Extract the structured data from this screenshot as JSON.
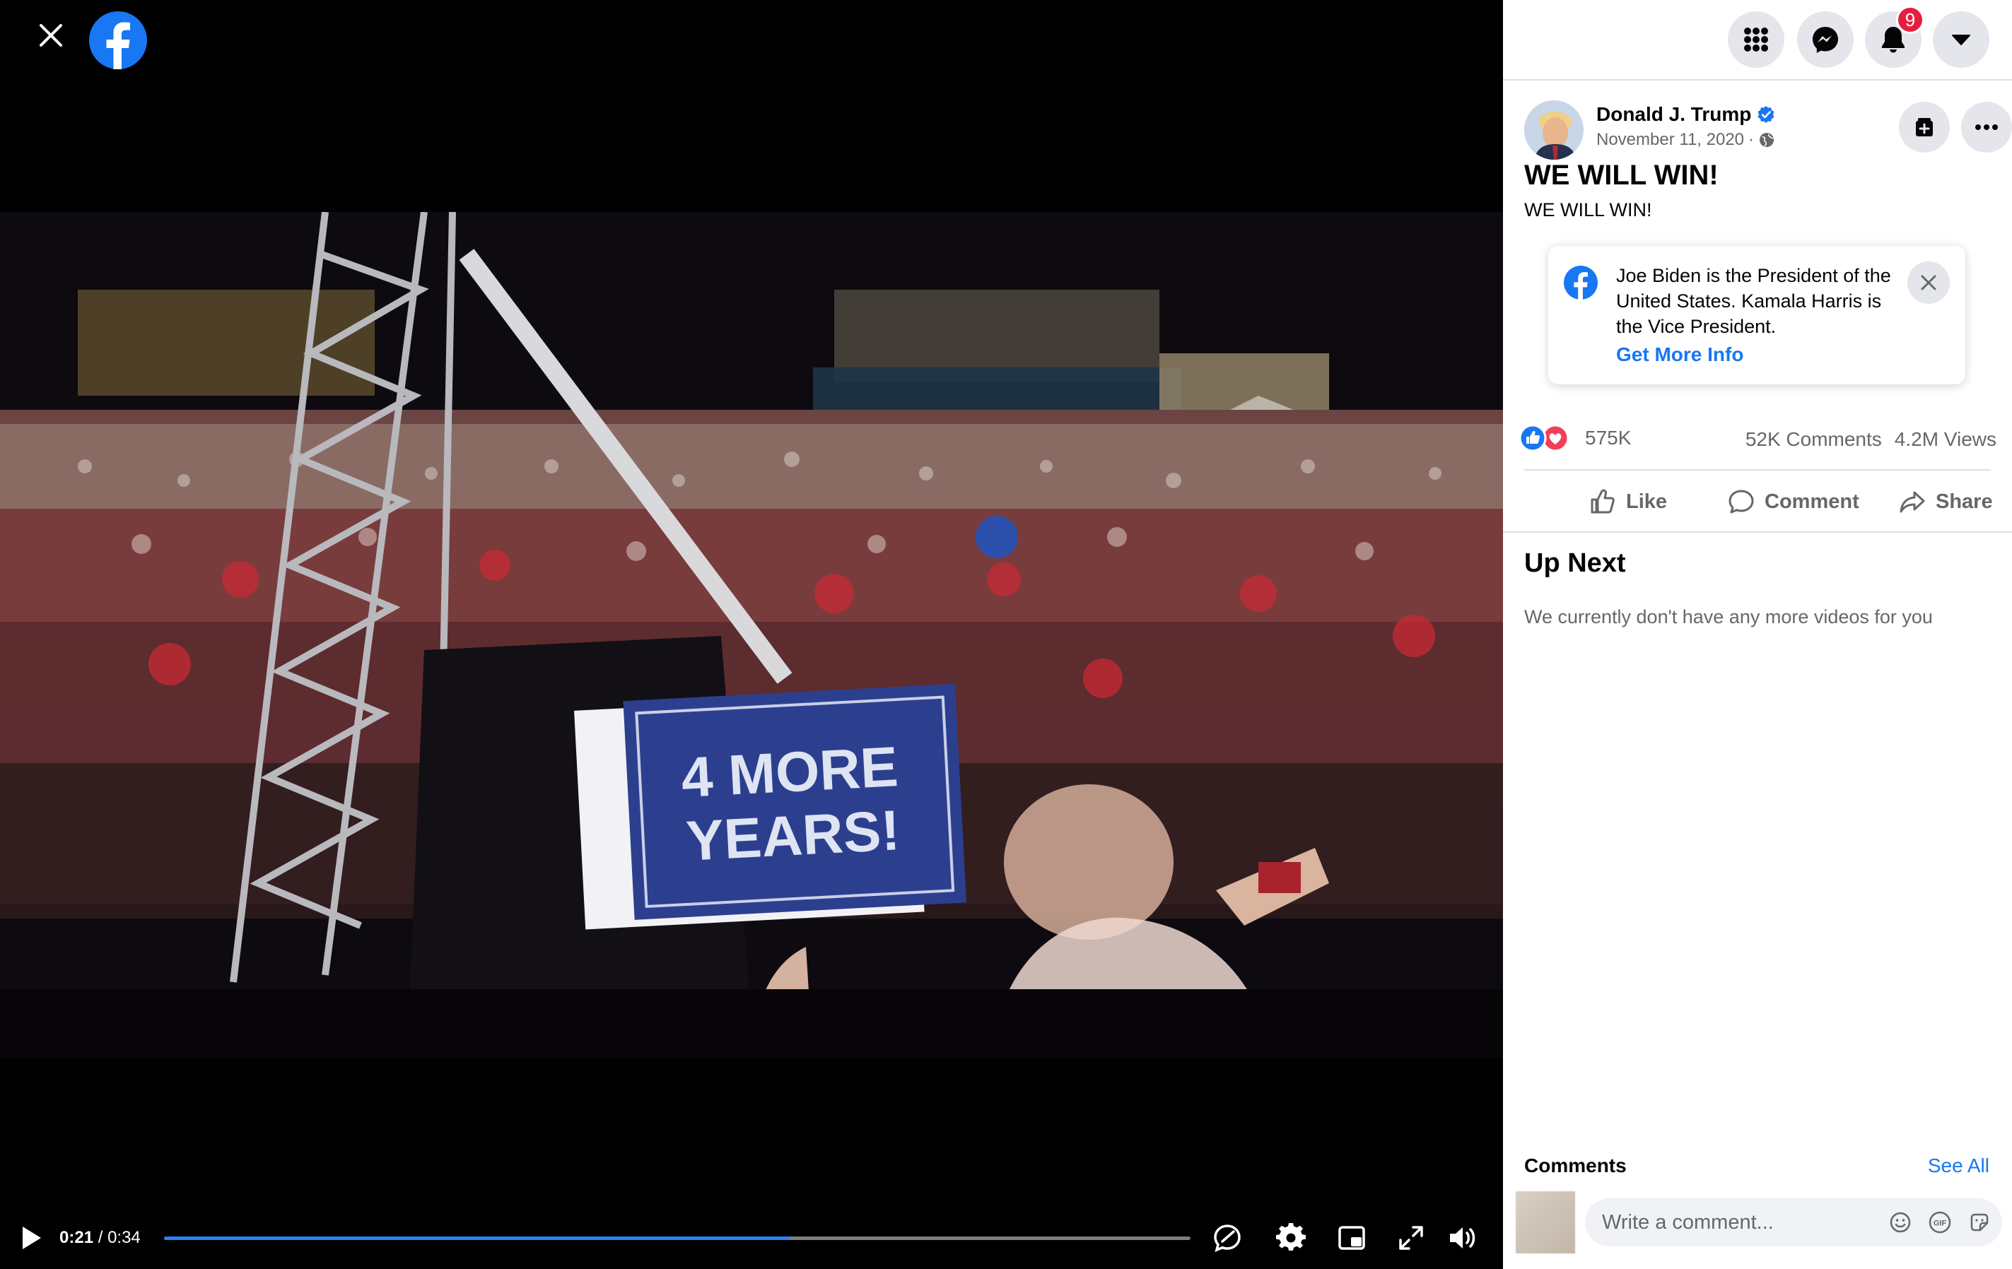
{
  "video": {
    "sign_text_line1": "4 MORE",
    "sign_text_line2": "YEARS!",
    "time_current": "0:21",
    "time_separator": " / ",
    "time_total": "0:34",
    "progress_fraction": 0.61
  },
  "nav": {
    "notification_count": "9"
  },
  "post": {
    "author": "Donald J. Trump",
    "date": "November 11, 2020",
    "date_separator": " · ",
    "title": "WE WILL WIN!",
    "text": "WE WILL WIN!"
  },
  "info_card": {
    "text": "Joe Biden is the President of the United States. Kamala Harris is the Vice President.",
    "link": "Get More Info"
  },
  "stats": {
    "reactions": "575K",
    "comments": "52K Comments",
    "views": "4.2M Views"
  },
  "actions": {
    "like": "Like",
    "comment": "Comment",
    "share": "Share"
  },
  "up_next": {
    "title": "Up Next",
    "empty": "We currently don't have any more videos for you"
  },
  "comments": {
    "label": "Comments",
    "see_all": "See All",
    "placeholder": "Write a comment..."
  },
  "colors": {
    "accent": "#1877f2",
    "progress": "#2d7ff9",
    "badge": "#e41e3f"
  }
}
